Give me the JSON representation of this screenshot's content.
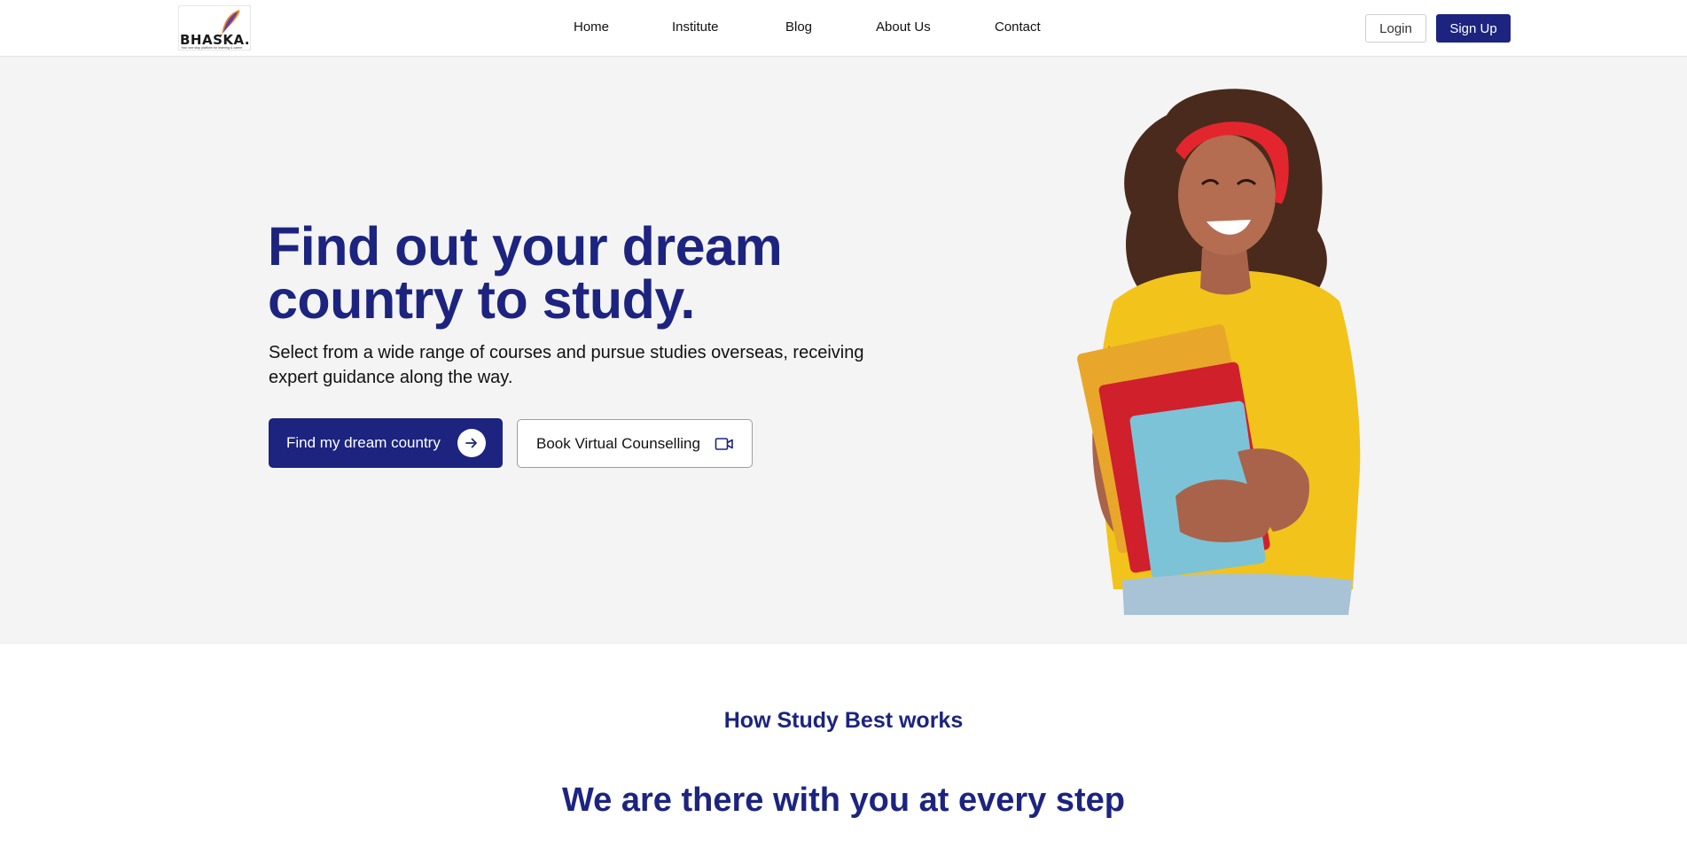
{
  "brand": {
    "name": "BHASKA.",
    "tagline": "Your one stop platform for learning & career",
    "colors": {
      "primary": "#1c2480",
      "hero_bg": "#f4f4f4"
    }
  },
  "nav": {
    "items": [
      "Home",
      "Institute",
      "Blog",
      "About Us",
      "Contact"
    ]
  },
  "auth": {
    "login_label": "Login",
    "signup_label": "Sign Up"
  },
  "hero": {
    "title": "Find out your dream country to study.",
    "subtitle": "Select from a wide range of courses and pursue studies overseas, receiving expert guidance along the way.",
    "primary_button": {
      "label": "Find my dream country",
      "icon": "arrow-right-icon"
    },
    "secondary_button": {
      "label": "Book Virtual Counselling",
      "icon": "video-camera-icon"
    }
  },
  "how_it_works": {
    "eyebrow": "How Study Best works",
    "title": "We are there with you at every step"
  }
}
